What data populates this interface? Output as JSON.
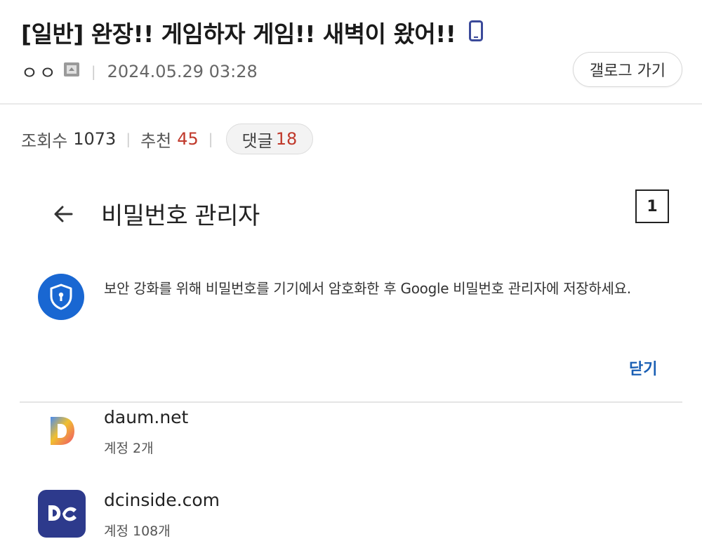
{
  "post": {
    "title": "[일반] 완장!! 게임하자 게임!! 새벽이 왔어!!",
    "author": "ㅇㅇ",
    "datetime": "2024.05.29 03:28",
    "gallery_button": "갤로그 가기",
    "stats": {
      "views_label": "조회수",
      "views": "1073",
      "recommend_label": "추천",
      "recommend": "45",
      "comments_label": "댓글",
      "comments": "18"
    }
  },
  "password_manager": {
    "title": "비밀번호 관리자",
    "marker": "1",
    "notice": "보안 강화를 위해 비밀번호를 기기에서 암호화한 후 Google 비밀번호 관리자에 저장하세요.",
    "close_label": "닫기",
    "sites": [
      {
        "name": "daum.net",
        "accounts": "계정 2개",
        "icon": "daum-logo-icon"
      },
      {
        "name": "dcinside.com",
        "accounts": "계정 108개",
        "icon": "dcinside-logo-icon"
      }
    ]
  },
  "colors": {
    "accent_blue": "#1967d2",
    "link_blue": "#1a5fb4",
    "count_red": "#c0392b",
    "dc_navy": "#2d3a8c"
  }
}
